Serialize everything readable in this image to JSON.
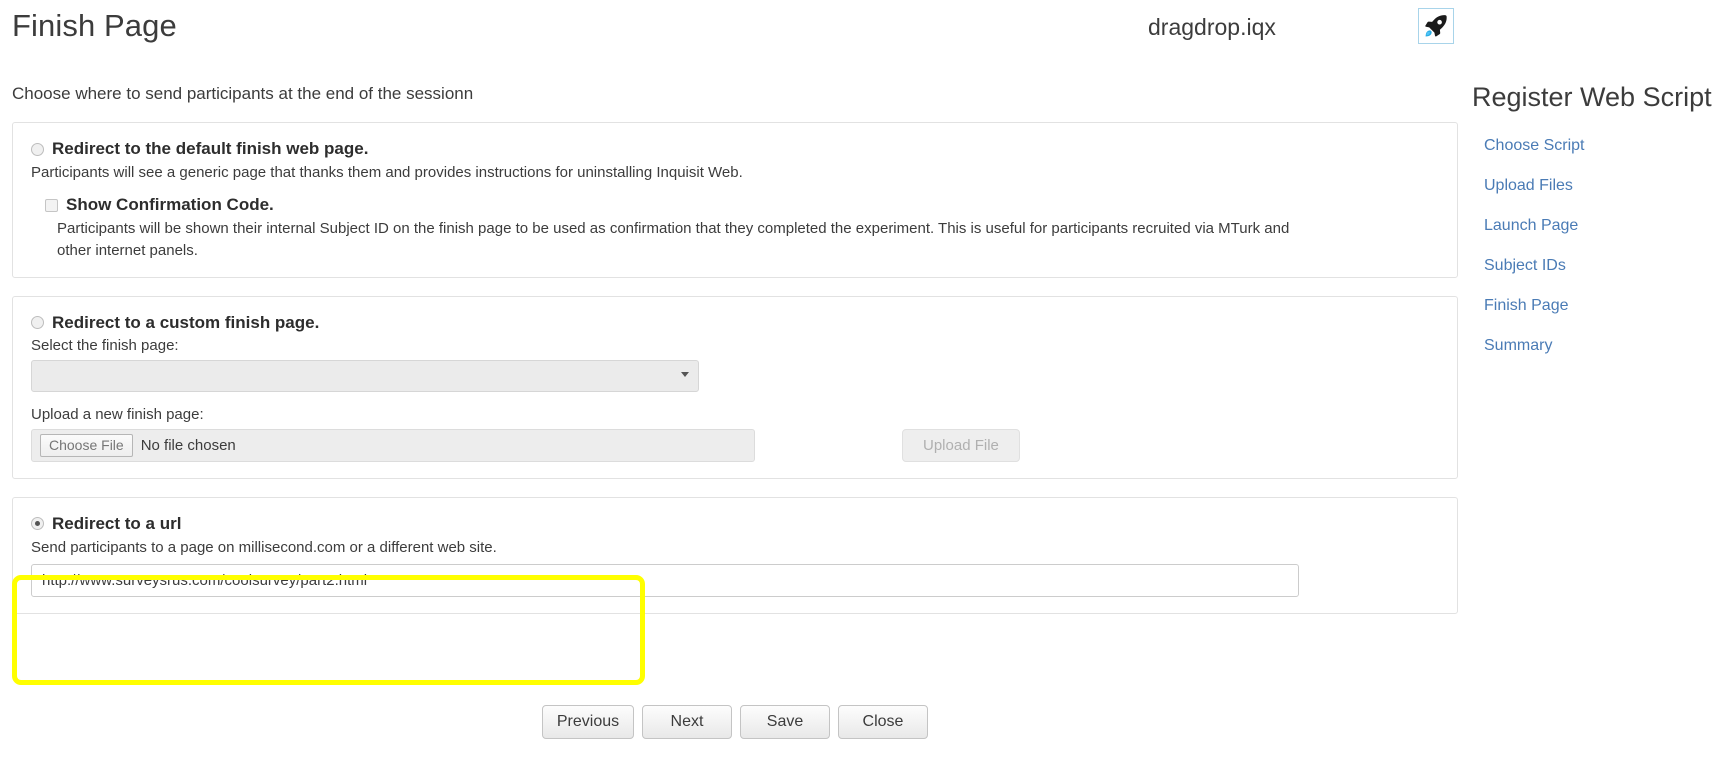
{
  "header": {
    "page_title": "Finish Page",
    "script_name": "dragdrop.iqx",
    "rocket_icon": "rocket-icon"
  },
  "main": {
    "intro": "Choose where to send participants at the end of the sessionn",
    "option_default": {
      "label": "Redirect to the default finish web page.",
      "selected": false,
      "description": "Participants will see a generic page that thanks them and provides instructions for uninstalling Inquisit Web.",
      "sub_option": {
        "label": "Show Confirmation Code.",
        "checked": false,
        "description": "Participants will be shown their internal Subject ID on the finish page to be used as confirmation that they completed the experiment. This is useful for participants recruited via MTurk and other internet panels."
      }
    },
    "option_custom": {
      "label": "Redirect to a custom finish page.",
      "selected": false,
      "select_label": "Select the finish page:",
      "select_value": "",
      "upload_label": "Upload a new finish page:",
      "choose_file_label": "Choose File",
      "file_status": "No file chosen",
      "upload_button_label": "Upload File"
    },
    "option_url": {
      "label": "Redirect to a url",
      "selected": true,
      "description": "Send participants to a page on millisecond.com or a different web site.",
      "url_value": "http://www.surveysrus.com/coolsurvey/part2.html",
      "url_placeholder": ""
    }
  },
  "buttons": {
    "previous": "Previous",
    "next": "Next",
    "save": "Save",
    "close": "Close"
  },
  "sidebar": {
    "title": "Register Web Script",
    "links": [
      {
        "label": "Choose Script"
      },
      {
        "label": "Upload Files"
      },
      {
        "label": "Launch Page"
      },
      {
        "label": "Subject IDs"
      },
      {
        "label": "Finish Page"
      },
      {
        "label": "Summary"
      }
    ]
  },
  "colors": {
    "highlight": "#ffff00",
    "link": "#4a7bb5",
    "panel_border": "#e2e2e2",
    "rocket_border": "#a8d4ea"
  }
}
